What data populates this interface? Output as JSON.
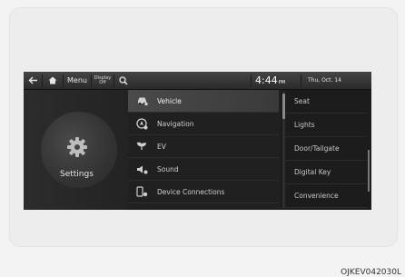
{
  "topbar": {
    "menu_label": "Menu",
    "display_off_line1": "Display",
    "display_off_line2": "Off",
    "time": "4:44",
    "ampm": "PM",
    "date": "Thu, Oct. 14"
  },
  "left": {
    "title": "Settings"
  },
  "menu": [
    {
      "label": "Vehicle",
      "icon": "car-icon",
      "selected": true
    },
    {
      "label": "Navigation",
      "icon": "navigation-icon"
    },
    {
      "label": "EV",
      "icon": "ev-icon"
    },
    {
      "label": "Sound",
      "icon": "speaker-icon"
    },
    {
      "label": "Device Connections",
      "icon": "device-connections-icon"
    }
  ],
  "submenu": [
    {
      "label": "Seat"
    },
    {
      "label": "Lights"
    },
    {
      "label": "Door/Tailgate"
    },
    {
      "label": "Digital Key"
    },
    {
      "label": "Convenience"
    }
  ],
  "caption": "OJKEV042030L"
}
